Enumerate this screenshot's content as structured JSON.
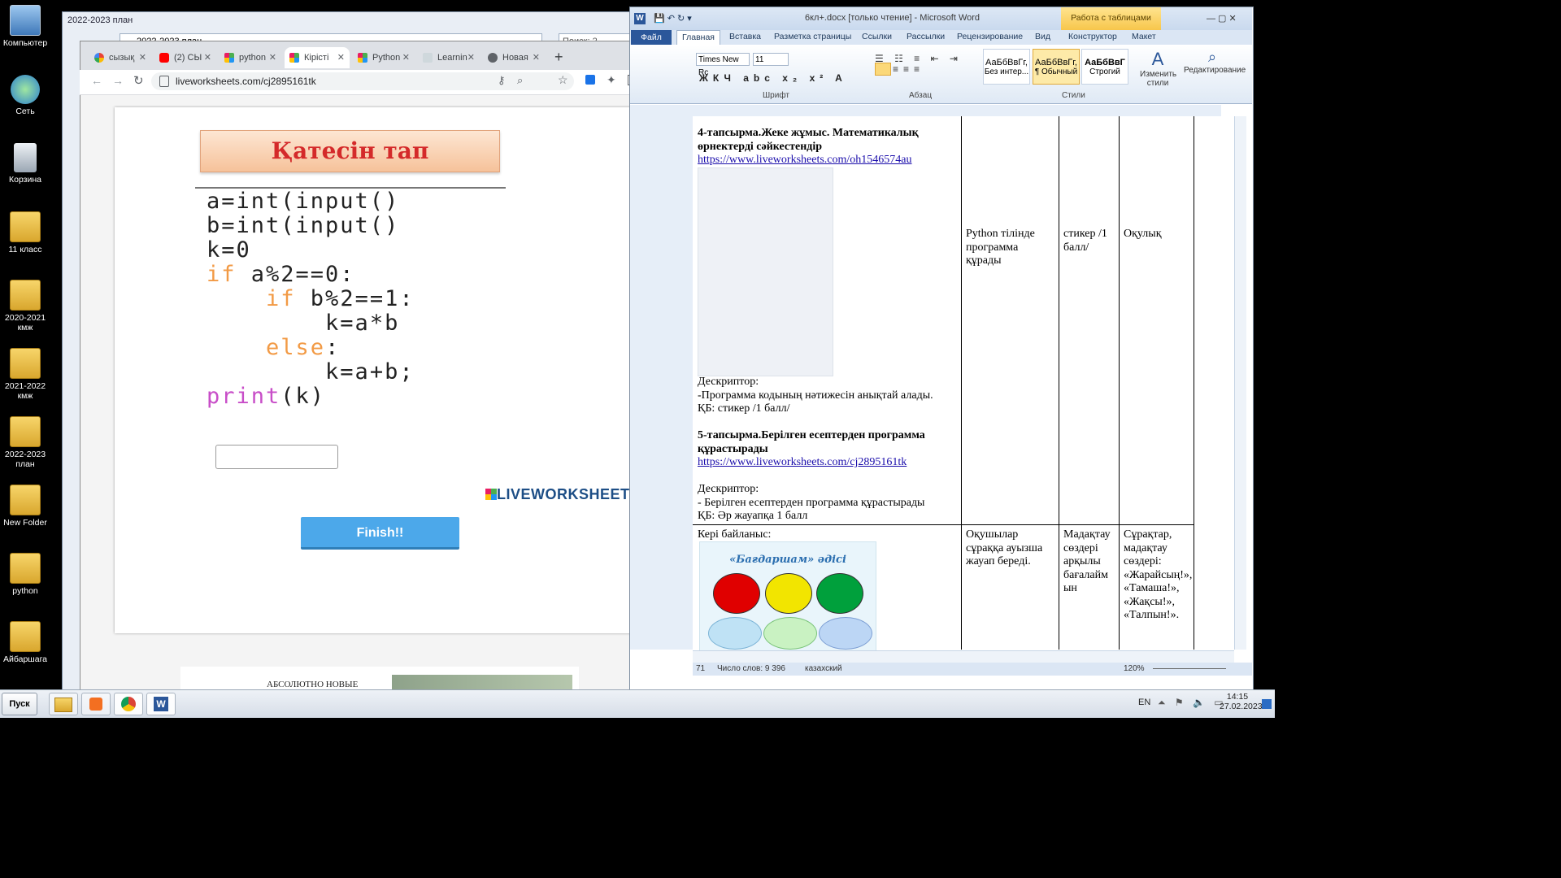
{
  "desktop": {
    "icons": [
      {
        "label": "Компьютер"
      },
      {
        "label": "Сеть"
      },
      {
        "label": "Корзина"
      },
      {
        "label": "11 класс"
      },
      {
        "label": "2020-2021 кмж"
      },
      {
        "label": "2021-2022 кмж"
      },
      {
        "label": "2022-2023 план"
      },
      {
        "label": "New Folder"
      },
      {
        "label": "python"
      },
      {
        "label": "Айбаршага"
      }
    ]
  },
  "explorer": {
    "title": "2022-2023 план",
    "breadcrumb": "2022-2023 план",
    "search_placeholder": "Поиск: 2"
  },
  "chrome": {
    "tabs": [
      {
        "label": "сызық",
        "icon": "google-icon"
      },
      {
        "label": "(2) СЫ",
        "icon": "youtube-icon"
      },
      {
        "label": "python",
        "icon": "liveworksheets-icon"
      },
      {
        "label": "Кірісті",
        "icon": "liveworksheets-icon"
      },
      {
        "label": "Python",
        "icon": "liveworksheets-icon"
      },
      {
        "label": "Learnin",
        "icon": "learning-icon"
      },
      {
        "label": "Новая",
        "icon": "globe-icon"
      }
    ],
    "new_tab_label": "+",
    "url": "liveworksheets.com/cj2895161tk"
  },
  "worksheet": {
    "banner_title": "Қатесін тап",
    "code_lines": [
      {
        "kw": "",
        "text": "a=int(input()"
      },
      {
        "kw": "",
        "text": "b=int(input()"
      },
      {
        "kw": "",
        "text": "k=0"
      },
      {
        "kw": "if",
        "text": " a%2==0:"
      },
      {
        "indent": "    ",
        "kw": "if",
        "text": " b%2==1:"
      },
      {
        "indent": "        ",
        "kw": "",
        "text": "k=a*b"
      },
      {
        "indent": "    ",
        "kw": "else",
        "text": ":"
      },
      {
        "indent": "        ",
        "kw": "",
        "text": "k=a+b;"
      },
      {
        "kw": "print",
        "text": "(k)"
      }
    ],
    "logo_text": "LIVEWORKSHEETS",
    "finish_label": "Finish!!",
    "ad_text": "АБСОЛЮТНО НОВЫЕ"
  },
  "word": {
    "title": "6кл+.docx [только чтение] - Microsoft Word",
    "context_tab": "Работа с таблицами",
    "tabs": [
      "Файл",
      "Главная",
      "Вставка",
      "Разметка страницы",
      "Ссылки",
      "Рассылки",
      "Рецензирование",
      "Вид",
      "Конструктор",
      "Макет"
    ],
    "font_name": "Times New Rc",
    "font_size": "11",
    "styles": [
      {
        "sample": "АаБбВвГг,",
        "name": "Без интер..."
      },
      {
        "sample": "АаБбВвГг,",
        "name": "¶ Обычный"
      },
      {
        "sample": "АаБбВвГ",
        "name": "Строгий"
      }
    ],
    "change_styles_label": "Изменить стили",
    "editing_label": "Редактирование",
    "group_labels": [
      "Шрифт",
      "Абзац",
      "Стили"
    ],
    "doc": {
      "task4_title": "4-тапсырма.Жеке жұмыс. Математикалық өрнектерді сәйкестендір",
      "task4_link": "https://www.liveworksheets.com/oh1546574au",
      "descriptor_label": "Дескриптор:",
      "descriptor4": "-Программа кодының нәтижесін анықтай алады.",
      "kb4": "ҚБ: стикер /1 балл/",
      "task5_title": "5-тапсырма.Берілген есептерден программа құрастырады",
      "task5_link": "https://www.liveworksheets.com/cj2895161tk",
      "descriptor5": "- Берілген есептерден программа құрастырады",
      "kb5": "ҚБ: Әр жауапқа 1 балл",
      "col2_row1": "Python тілінде программа құрады",
      "col3_row1": "стикер /1 балл/",
      "col4_row1": "Оқулық",
      "feedback_label": "Кері байланыс:",
      "feedback_image_title": "«Бағдаршам» әдісі",
      "col2_row2": "Оқушылар сұраққа ауызша жауап береді.",
      "col3_row2": "Мадақтау сөздері арқылы бағалайм ын",
      "col4_row2": "Сұрақтар, мадақтау сөздері: «Жарайсың!», «Тамаша!», «Жақсы!», «Талпын!»."
    },
    "status": {
      "page": "71",
      "words": "Число слов: 9 396",
      "language": "казахский",
      "zoom": "120%"
    }
  },
  "taskbar": {
    "start_label": "Пуск",
    "lang": "EN",
    "time": "14:15",
    "date": "27.02.2023"
  },
  "colors": {
    "banner_text": "#d42a2a",
    "keyword_purple": "#c84ec8",
    "keyword_orange": "#f29a45",
    "finish_button": "#4ca8ea",
    "link": "#1a0dab"
  }
}
